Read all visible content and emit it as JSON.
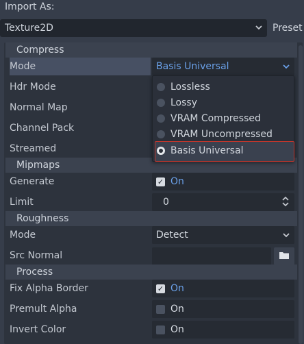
{
  "header": {
    "import_as_label": "Import As:",
    "importer_value": "Texture2D",
    "preset_label": "Preset"
  },
  "sections": {
    "compress": "Compress",
    "mipmaps": "Mipmaps",
    "roughness": "Roughness",
    "process": "Process"
  },
  "compress": {
    "mode_label": "Mode",
    "mode_value": "Basis Universal",
    "hdr_mode_label": "Hdr Mode",
    "normal_map_label": "Normal Map",
    "channel_pack_label": "Channel Pack",
    "streamed_label": "Streamed"
  },
  "mode_dropdown": {
    "options": [
      "Lossless",
      "Lossy",
      "VRAM Compressed",
      "VRAM Uncompressed",
      "Basis Universal"
    ],
    "selected": "Basis Universal"
  },
  "mipmaps": {
    "generate_label": "Generate",
    "generate_value": "On",
    "limit_label": "Limit",
    "limit_value": "0"
  },
  "roughness": {
    "mode_label": "Mode",
    "mode_value": "Detect",
    "src_normal_label": "Src Normal",
    "src_normal_value": ""
  },
  "process": {
    "fix_alpha_border_label": "Fix Alpha Border",
    "fix_alpha_border_value": "On",
    "premult_alpha_label": "Premult Alpha",
    "premult_alpha_value": "On",
    "invert_color_label": "Invert Color",
    "invert_color_value": "On"
  },
  "colors": {
    "background": "#363d4a",
    "accent": "#6aa0e8",
    "selection_outline": "#c0362c"
  }
}
